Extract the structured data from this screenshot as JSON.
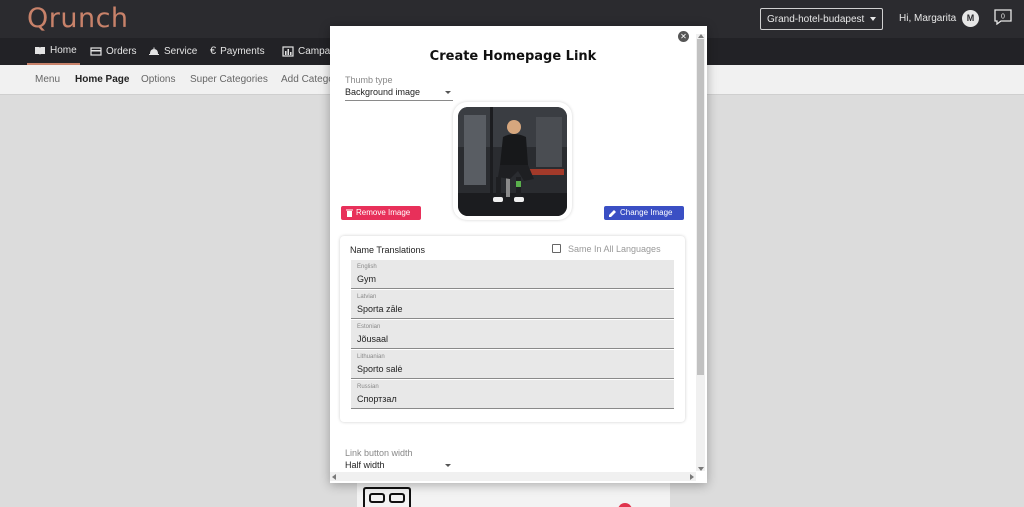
{
  "app": {
    "logo": "Qrunch"
  },
  "header": {
    "hotel_select": "Grand-hotel-budapest",
    "greeting": "Hi, Margarita",
    "avatar_initial": "M",
    "chat_count": "0"
  },
  "mainnav": {
    "items": [
      {
        "label": "Home",
        "icon": "book-icon"
      },
      {
        "label": "Orders",
        "icon": "card-icon"
      },
      {
        "label": "Service",
        "icon": "bell-icon"
      },
      {
        "label": "Payments",
        "icon": "euro-icon"
      },
      {
        "label": "Campa",
        "icon": "chart-icon"
      }
    ]
  },
  "subnav": {
    "items": [
      "Menu",
      "Home Page",
      "Options",
      "Super Categories",
      "Add Catego"
    ]
  },
  "modal": {
    "title": "Create Homepage Link",
    "thumb_type_label": "Thumb type",
    "thumb_type_value": "Background image",
    "remove_image": "Remove Image",
    "change_image": "Change Image",
    "translations_title": "Name Translations",
    "same_all_label": "Same In All Languages",
    "translations": [
      {
        "lang": "English",
        "value": "Gym"
      },
      {
        "lang": "Latvian",
        "value": "Sporta zāle"
      },
      {
        "lang": "Estonian",
        "value": "Jõusaal"
      },
      {
        "lang": "Lithuanian",
        "value": "Sporto salė"
      },
      {
        "lang": "Russian",
        "value": "Спортзал"
      }
    ],
    "link_width_label": "Link button width",
    "link_width_value": "Half width"
  },
  "colors": {
    "accent": "#c8826a",
    "danger": "#e8305a",
    "primary": "#3a4fc4",
    "topbar": "#2b2b2f"
  }
}
